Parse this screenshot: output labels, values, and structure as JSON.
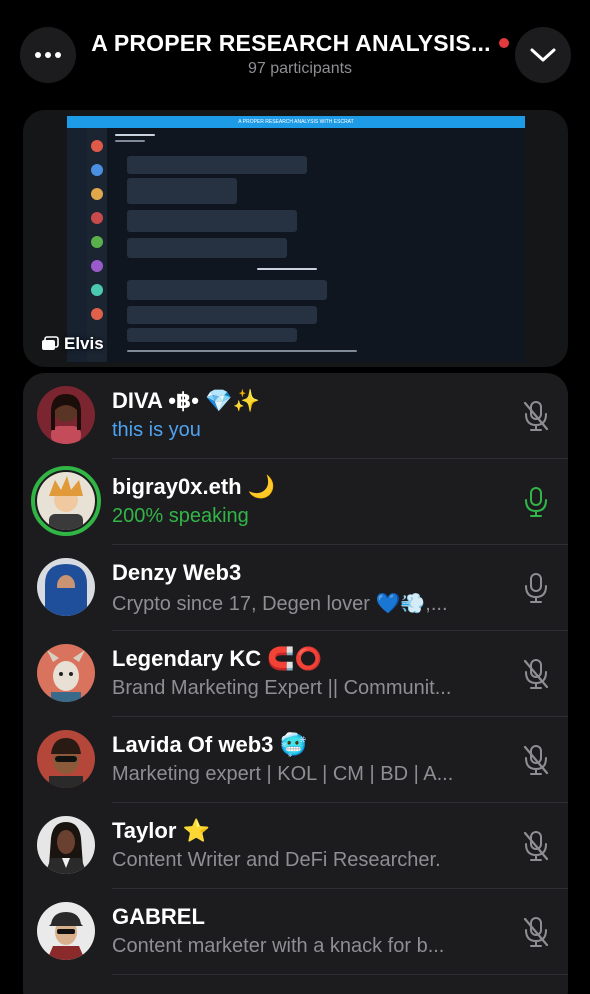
{
  "header": {
    "title": "A PROPER RESEARCH ANALYSIS...",
    "subtitle": "97 participants",
    "menu_icon": "more-horizontal-icon",
    "collapse_icon": "chevron-down-icon",
    "recording_color": "#e0393e"
  },
  "screen_share": {
    "presenter": "Elvis",
    "icon": "screen-share-icon",
    "shared_window_title": "A PROPER RESEARCH ANALYSIS WITH ESCRAT",
    "shared_chat": {
      "header": "Discussion",
      "divider": "Unread messages"
    }
  },
  "participants": [
    {
      "name": "DIVA •฿•",
      "emoji": "💎✨",
      "status": "this is you",
      "status_kind": "you",
      "mic": "mic-off-icon",
      "avatar_color": "#7a2530"
    },
    {
      "name": "bigray0x.eth",
      "emoji": "🌙",
      "status": "200% speaking",
      "status_kind": "speaking",
      "mic": "mic-on-icon",
      "avatar_color": "#c98a3b"
    },
    {
      "name": "Denzy Web3",
      "emoji": "",
      "status": "Crypto since 17, Degen lover 💙💨,...",
      "status_kind": "normal",
      "mic": "mic-on-icon",
      "avatar_color": "#2c5aa0"
    },
    {
      "name": "Legendary KC",
      "emoji": "🧲⭕",
      "status": "Brand Marketing Expert || Communit...",
      "status_kind": "normal",
      "mic": "mic-off-icon",
      "avatar_color": "#d9735e"
    },
    {
      "name": "Lavida Of web3",
      "emoji": "🥶",
      "status": "Marketing expert | KOL | CM | BD | A...",
      "status_kind": "normal",
      "mic": "mic-off-icon",
      "avatar_color": "#b5463a"
    },
    {
      "name": "Taylor",
      "emoji": "⭐",
      "status": "Content Writer and DeFi Researcher.",
      "status_kind": "normal",
      "mic": "mic-off-icon",
      "avatar_color": "#3c3c3c"
    },
    {
      "name": "GABREL",
      "emoji": "",
      "status": "Content marketer with a knack for b...",
      "status_kind": "normal",
      "mic": "mic-off-icon",
      "avatar_color": "#6b5a4e"
    }
  ],
  "colors": {
    "background": "#000000",
    "panel": "#1c1c1e",
    "you_color": "#4ea3f0",
    "speaking_color": "#32b548",
    "muted_icon": "#8e8e93"
  }
}
